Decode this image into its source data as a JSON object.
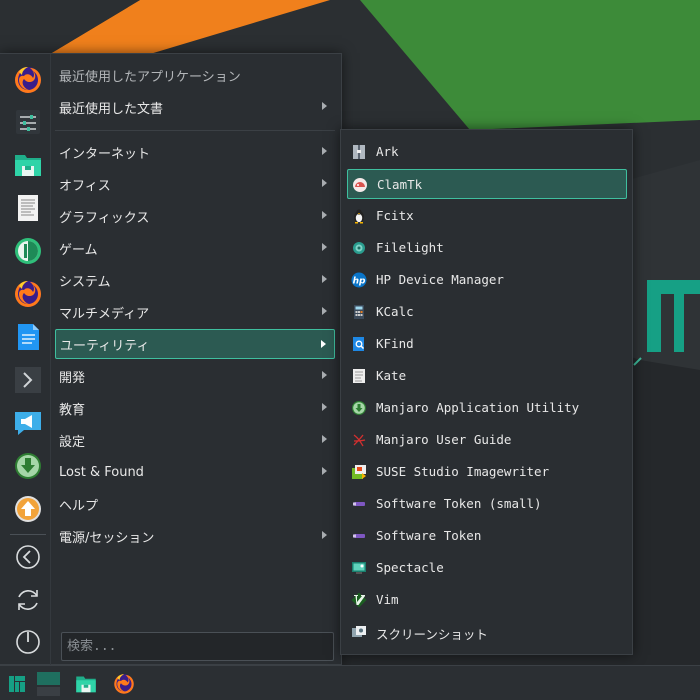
{
  "menu": {
    "categories": [
      {
        "label": "最近使用したアプリケーション",
        "name": "recent-apps",
        "type": "header"
      },
      {
        "label": "最近使用した文書",
        "name": "recent-docs",
        "type": "submenu"
      },
      {
        "label": "インターネット",
        "name": "internet",
        "type": "submenu"
      },
      {
        "label": "オフィス",
        "name": "office",
        "type": "submenu"
      },
      {
        "label": "グラフィックス",
        "name": "graphics",
        "type": "submenu"
      },
      {
        "label": "ゲーム",
        "name": "games",
        "type": "submenu"
      },
      {
        "label": "システム",
        "name": "system",
        "type": "submenu"
      },
      {
        "label": "マルチメディア",
        "name": "multimedia",
        "type": "submenu"
      },
      {
        "label": "ユーティリティ",
        "name": "utilities",
        "type": "submenu",
        "active": true
      },
      {
        "label": "開発",
        "name": "development",
        "type": "submenu"
      },
      {
        "label": "教育",
        "name": "education",
        "type": "submenu"
      },
      {
        "label": "設定",
        "name": "settings",
        "type": "submenu"
      },
      {
        "label": "Lost & Found",
        "name": "lost-and-found",
        "type": "submenu"
      },
      {
        "label": "ヘルプ",
        "name": "help",
        "type": "item"
      },
      {
        "label": "電源/セッション",
        "name": "power-session",
        "type": "submenu"
      }
    ],
    "search_placeholder": "検索..."
  },
  "favorites": [
    "firefox-icon",
    "system-settings-icon",
    "file-manager-icon",
    "text-editor-icon",
    "pamac-icon",
    "firefox-icon",
    "document-icon",
    "terminal-icon",
    "announcement-icon",
    "download-icon",
    "upload-icon",
    "back-icon",
    "refresh-icon",
    "power-icon"
  ],
  "submenu": {
    "items": [
      {
        "label": "Ark",
        "icon": "ark-icon"
      },
      {
        "label": "ClamTk",
        "icon": "clamtk-icon",
        "active": true
      },
      {
        "label": "Fcitx",
        "icon": "penguin-icon"
      },
      {
        "label": "Filelight",
        "icon": "filelight-icon"
      },
      {
        "label": "HP Device Manager",
        "icon": "hp-icon"
      },
      {
        "label": "KCalc",
        "icon": "calculator-icon"
      },
      {
        "label": "KFind",
        "icon": "kfind-icon"
      },
      {
        "label": "Kate",
        "icon": "kate-icon"
      },
      {
        "label": "Manjaro Application Utility",
        "icon": "manjaro-app-utility-icon"
      },
      {
        "label": "Manjaro User Guide",
        "icon": "pdf-icon"
      },
      {
        "label": "SUSE Studio Imagewriter",
        "icon": "imagewriter-icon"
      },
      {
        "label": "Software Token (small)",
        "icon": "token-icon"
      },
      {
        "label": "Software Token",
        "icon": "token-icon"
      },
      {
        "label": "Spectacle",
        "icon": "spectacle-icon"
      },
      {
        "label": "Vim",
        "icon": "vim-icon"
      },
      {
        "label": "スクリーンショット",
        "icon": "screenshot-icon"
      }
    ]
  },
  "taskbar": {
    "items": [
      "manjaro-menu-icon",
      "desktop-pager-icon",
      "file-manager-icon",
      "firefox-icon"
    ]
  },
  "colors": {
    "accent": "#3fbf9f",
    "highlight_bg": "#2c5a52",
    "menu_bg": "#2a2e32",
    "wallpaper_orange": "#f0801c",
    "wallpaper_green": "#3d8b39",
    "manjaro_green": "#16a085"
  }
}
